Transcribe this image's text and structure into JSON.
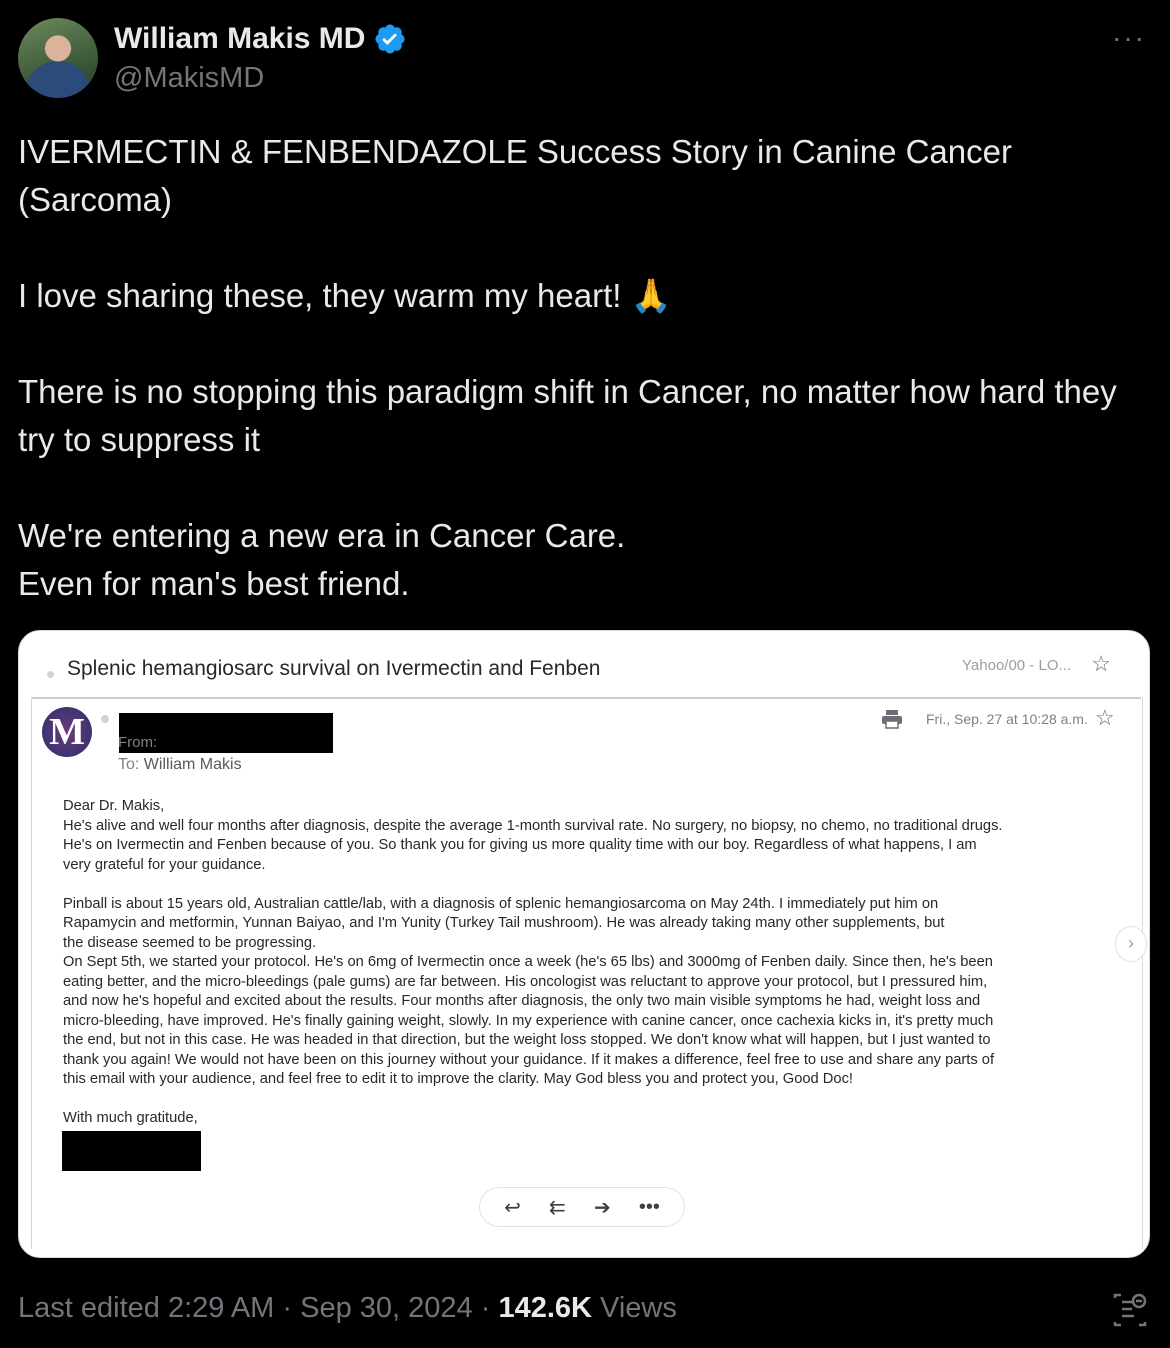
{
  "author": {
    "display_name": "William Makis MD",
    "handle": "@MakisMD",
    "verified_icon": "verified-badge-icon"
  },
  "more_label": "···",
  "tweet": {
    "text": "IVERMECTIN & FENBENDAZOLE Success Story in Canine Cancer\n(Sarcoma)\n\nI love sharing these, they warm my heart! 🙏\n\nThere is no stopping this paradigm shift in Cancer, no matter how hard they try to suppress it\n\nWe're entering a new era in Cancer Care.\nEven for man's best friend."
  },
  "email": {
    "subject": "Splenic hemangiosarc survival on Ivermectin and Fenben",
    "folder": "Yahoo/00 - LO...",
    "logo_letter": "M",
    "from_label": "From:",
    "to_label": "To:",
    "to_value": "William Makis",
    "date": "Fri., Sep. 27 at 10:28 a.m.",
    "body": "Dear Dr. Makis,\nHe's alive and well four months after diagnosis, despite the average 1-month survival rate. No surgery, no biopsy, no chemo, no traditional drugs.\nHe's on Ivermectin and Fenben because of you. So thank you for giving us more quality time with our boy. Regardless of what happens, I am\nvery grateful for your guidance.\n\nPinball is about 15 years old, Australian cattle/lab, with a diagnosis of splenic hemangiosarcoma on May 24th. I immediately put him on\nRapamycin and metformin, Yunnan Baiyao, and I'm Yunity (Turkey Tail mushroom). He was already taking many other supplements, but\nthe disease seemed to be progressing.\nOn Sept 5th, we started your protocol. He's on 6mg of Ivermectin once a week (he's 65 lbs) and 3000mg of Fenben daily. Since then, he's been\neating better, and the micro-bleedings (pale gums) are far between. His oncologist was reluctant to approve your protocol, but I pressured him,\nand now he's hopeful and excited about the results. Four months after diagnosis, the only two main visible symptoms he had, weight loss and\nmicro-bleeding, have improved. He's finally gaining weight, slowly. In my experience with canine cancer, once cachexia kicks in, it's pretty much\nthe end, but not in this case. He was headed in that direction, but the weight loss stopped. We don't know what will happen, but I just wanted to\nthank you again! We would not have been on this journey without your guidance. If it makes a difference, feel free to use and share any parts of\nthis email with your audience, and feel free to edit it to improve the clarity. May God bless you and protect you, Good Doc!\n\nWith much gratitude,",
    "actions": [
      "reply-icon",
      "reply-all-icon",
      "forward-icon",
      "more-icon"
    ]
  },
  "footer": {
    "edited": "Last edited 2:29 AM · Sep 30, 2024 · ",
    "views_count": "142.6K",
    "views_label": " Views"
  }
}
